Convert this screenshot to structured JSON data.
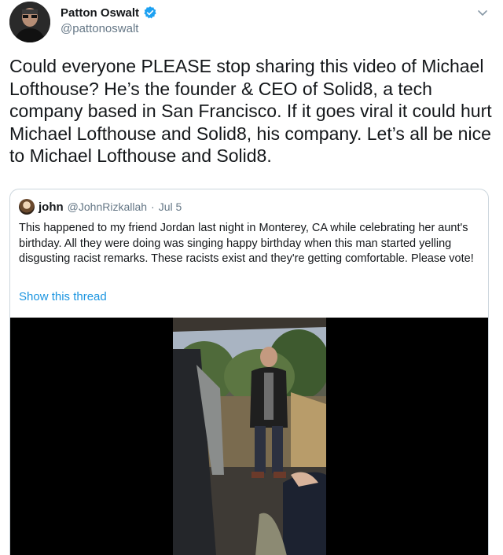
{
  "author": {
    "name": "Patton Oswalt",
    "handle": "@pattonoswalt",
    "verified": true,
    "avatar_icon": "profile-photo"
  },
  "tweet": {
    "text": "Could everyone PLEASE stop sharing this video of Michael Lofthouse? He’s the founder & CEO of Solid8, a tech company based in San Francisco. If it goes viral it could hurt Michael Lofthouse and Solid8, his company. Let’s all be nice to Michael Lofthouse and Solid8."
  },
  "quoted": {
    "name": "john",
    "handle": "@JohnRizkallah",
    "separator": "·",
    "date": "Jul 5",
    "text": "This happened to my friend Jordan last night in Monterey, CA while celebrating her aunt's birthday. All they were doing was singing happy birthday when this man started yelling disgusting racist remarks. These racists exist and they're getting comfortable. Please vote!",
    "link": "Show this thread"
  },
  "colors": {
    "accent": "#1b95e0",
    "secondary_text": "#657786",
    "border": "#ccd6dd",
    "verified": "#1da1f2"
  }
}
